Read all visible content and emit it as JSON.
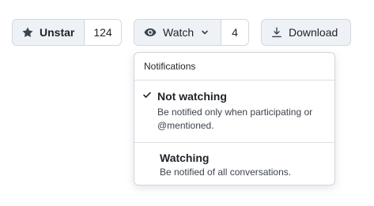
{
  "star": {
    "label": "Unstar",
    "count": "124",
    "icon": "star-icon"
  },
  "watch": {
    "label": "Watch",
    "count": "4",
    "icon": "eye-icon",
    "caret_icon": "chevron-down-icon"
  },
  "download": {
    "label": "Download",
    "icon": "download-icon"
  },
  "notifications_menu": {
    "header": "Notifications",
    "items": [
      {
        "title": "Not watching",
        "description": "Be notified only when participating or @mentioned.",
        "selected": true
      },
      {
        "title": "Watching",
        "description": "Be notified of all conversations.",
        "selected": false
      }
    ]
  },
  "colors": {
    "button_bg": "#eef2f7",
    "border": "#d0d7de",
    "text": "#1f2328"
  }
}
